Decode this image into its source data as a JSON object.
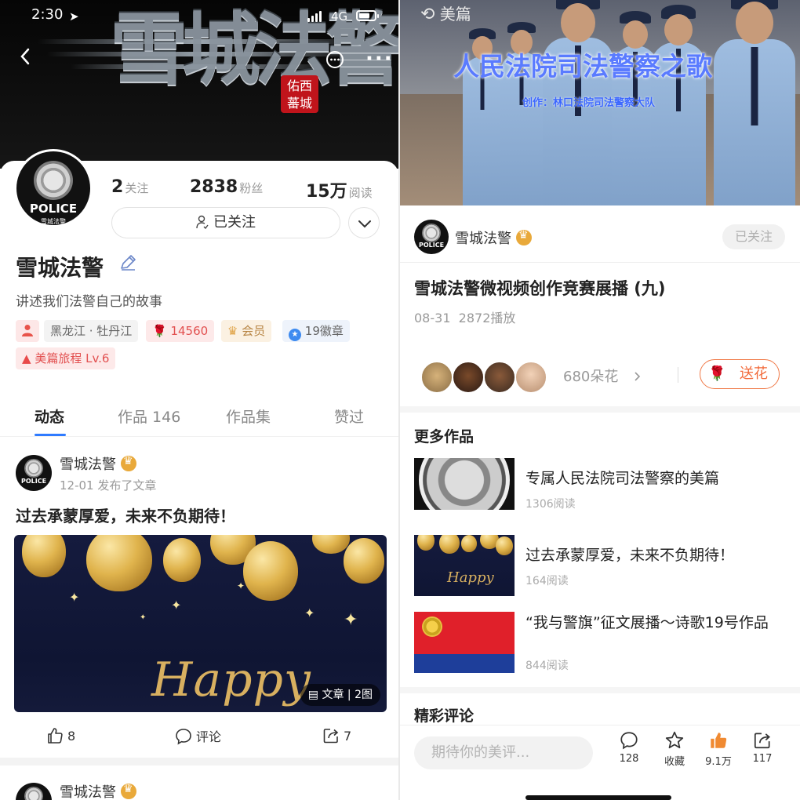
{
  "left": {
    "status_bar": {
      "time": "2:30",
      "network": "4G"
    },
    "banner": {
      "title": "雪城法警",
      "seal_text": "佑西 蕃城"
    },
    "avatar": {
      "badge_text": "POLICE",
      "sub_text": "雪城法警"
    },
    "stats": [
      {
        "value": "2",
        "label": "关注"
      },
      {
        "value": "2838",
        "label": "粉丝"
      },
      {
        "value": "15万",
        "label": "阅读"
      }
    ],
    "follow_button": "已关注",
    "profile": {
      "name": "雪城法警",
      "bio": "讲述我们法警自己的故事",
      "tags": {
        "location": "黑龙江 · 牡丹江",
        "flowers": "14560",
        "member": "会员",
        "badges": "19徽章",
        "level": "美篇旅程 Lv.6"
      }
    },
    "tabs": [
      "动态",
      "作品 146",
      "作品集",
      "赞过"
    ],
    "feed": {
      "author": "雪城法警",
      "meta": "12-01 发布了文章",
      "title": "过去承蒙厚爱，未来不负期待！",
      "image_text": "Happy",
      "badge": "文章 | 2图",
      "likes": "8",
      "comment_label": "评论",
      "shares": "7",
      "next_author": "雪城法警"
    }
  },
  "right": {
    "video": {
      "watermark": "美篇",
      "title": "人民法院司法警察之歌",
      "subtitle": "创作：林口法院司法警察大队"
    },
    "author": "雪城法警",
    "followed": "已关注",
    "article": {
      "title": "雪城法警微视频创作竞赛展播 (九)",
      "date": "08-31",
      "plays": "2872播放"
    },
    "flowers": {
      "count_label": "680朵花",
      "send_label": "送花"
    },
    "more_works": {
      "heading": "更多作品",
      "items": [
        {
          "title": "专属人民法院司法警察的美篇",
          "reads": "1306阅读",
          "thumb_text": ""
        },
        {
          "title": "过去承蒙厚爱，未来不负期待！",
          "reads": "164阅读",
          "thumb_text": "Happy"
        },
        {
          "title": "“我与警旗”征文展播～诗歌19号作品",
          "reads": "844阅读",
          "thumb_text": ""
        }
      ]
    },
    "comments_heading": "精彩评论",
    "bottom_bar": {
      "placeholder": "期待你的美评...",
      "comments": "128",
      "favorite": "收藏",
      "likes": "9.1万",
      "shares": "117"
    }
  },
  "colors": {
    "accent_blue": "#2f7bff",
    "flower_orange": "#f26a3a",
    "crown_gold": "#e9a93a",
    "flag_red": "#e0202a",
    "flag_blue": "#1e3e9a"
  }
}
